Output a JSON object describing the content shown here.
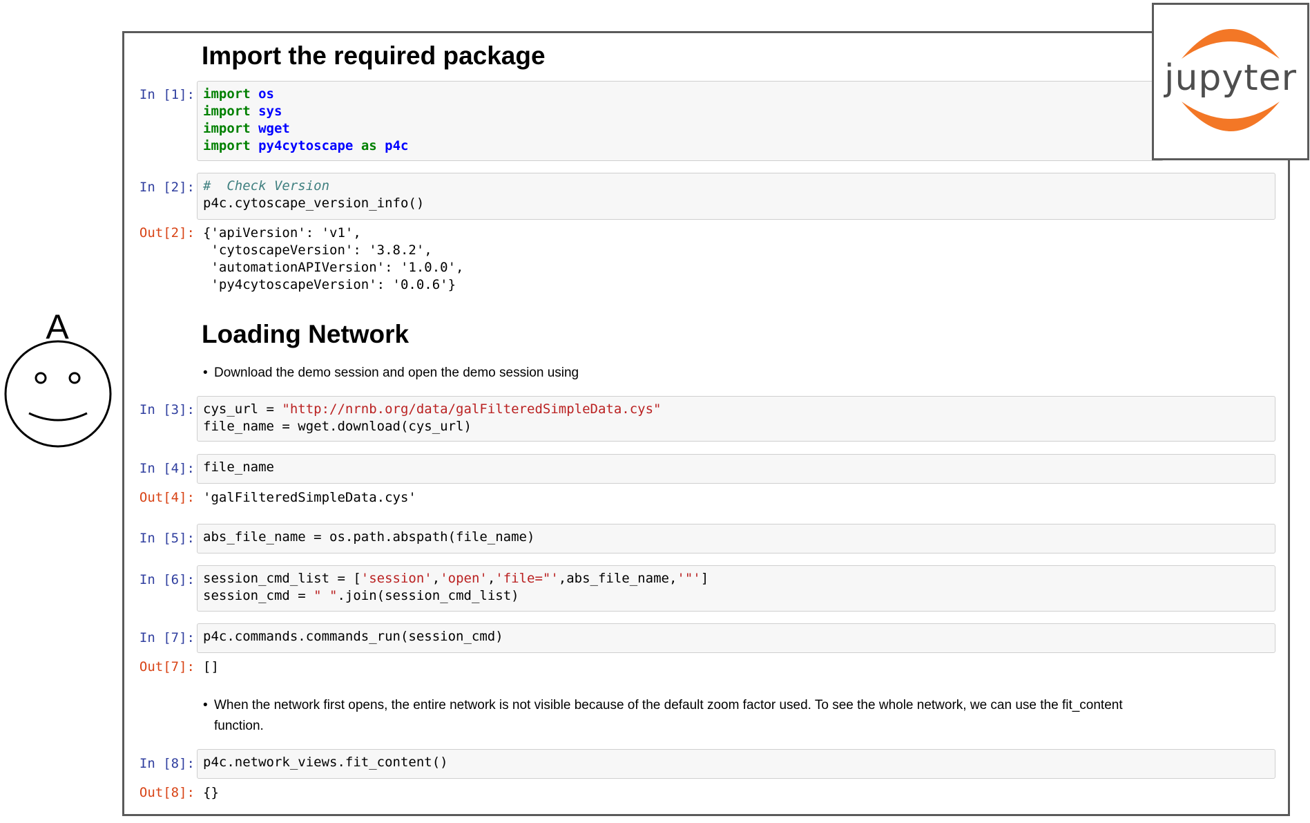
{
  "logo": {
    "wordmark": "jupyter",
    "arc_color": "#f37726"
  },
  "user": {
    "label": "A"
  },
  "notebook": {
    "heading_1": "Import the required package",
    "heading_2": "Loading Network",
    "cells": [
      {
        "prompt": "In [1]:",
        "lines": [
          "import os",
          "import sys",
          "import wget",
          "import py4cytoscape as p4c"
        ]
      },
      {
        "prompt": "In [2]:",
        "lines": [
          "# Check Version",
          "p4c.cytoscape_version_info()"
        ],
        "out_prompt": "Out[2]:",
        "output": [
          "{'apiVersion': 'v1',",
          " 'cytoscapeVersion': '3.8.2',",
          " 'automationAPIVersion': '1.0.0',",
          " 'py4cytoscapeVersion': '0.0.6'}"
        ]
      },
      {
        "prompt": "In [3]:",
        "lines": [
          "cys_url = \"http://nrnb.org/data/galFilteredSimpleData.cys\"",
          "file_name = wget.download(cys_url)"
        ]
      },
      {
        "prompt": "In [4]:",
        "lines": [
          "file_name"
        ],
        "out_prompt": "Out[4]:",
        "output": [
          "'galFilteredSimpleData.cys'"
        ]
      },
      {
        "prompt": "In [5]:",
        "lines": [
          "abs_file_name = os.path.abspath(file_name)"
        ]
      },
      {
        "prompt": "In [6]:",
        "lines": [
          "session_cmd_list = ['session','open','file=\"',abs_file_name,'\"']",
          "session_cmd = \" \".join(session_cmd_list)"
        ]
      },
      {
        "prompt": "In [7]:",
        "lines": [
          "p4c.commands.commands_run(session_cmd)"
        ],
        "out_prompt": "Out[7]:",
        "output": [
          "[]"
        ]
      },
      {
        "prompt": "In [8]:",
        "lines": [
          "p4c.network_views.fit_content()"
        ],
        "out_prompt": "Out[8]:",
        "output": [
          "{}"
        ]
      }
    ],
    "bullet_1": "Download the demo session and open the demo session using",
    "bullet_2_line_1": "When the network first opens, the entire network is not visible because of the default zoom factor used. To see the whole network, we can use the fit_content",
    "bullet_2_line_2": "function."
  }
}
